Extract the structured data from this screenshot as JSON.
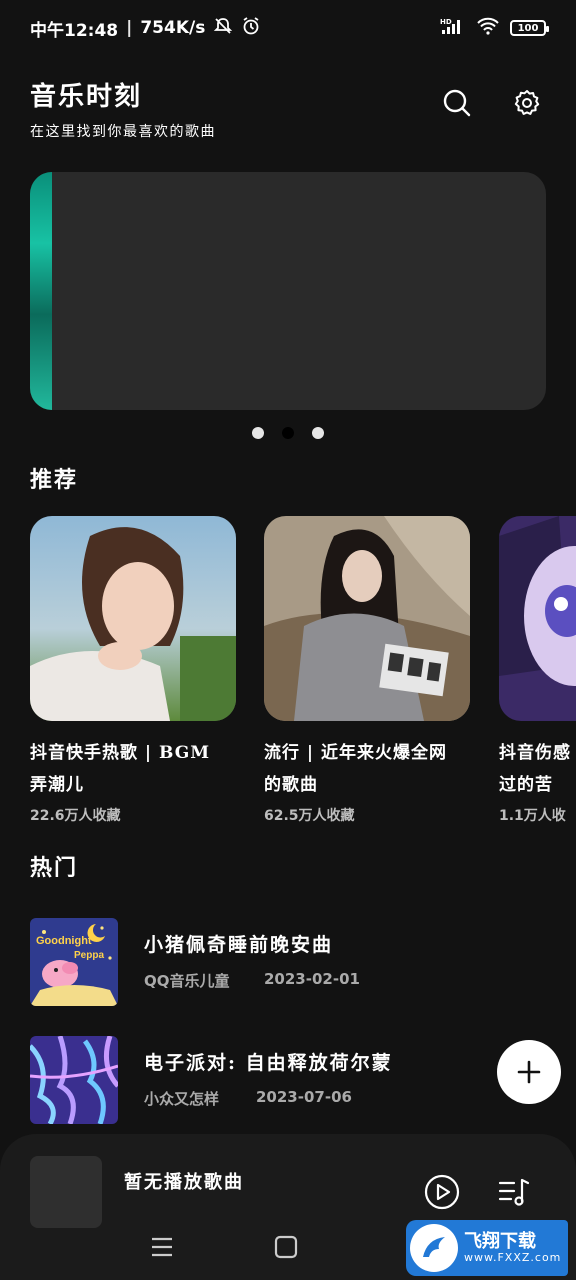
{
  "status": {
    "time": "中午12:48",
    "speed": "754K/s",
    "network": "HD",
    "battery": "100"
  },
  "header": {
    "title": "音乐时刻",
    "subtitle": "在这里找到你最喜欢的歌曲",
    "search_icon": "search-icon",
    "settings_icon": "gear-icon"
  },
  "banner": {
    "page_count": 3,
    "active_index": 1
  },
  "recommend": {
    "title": "推荐",
    "items": [
      {
        "title_line1": "抖音快手热歌 | BGM",
        "title_line2": "弄潮儿",
        "favorites": "22.6万人收藏"
      },
      {
        "title_line1": "流行 | 近年来火爆全网",
        "title_line2": "的歌曲",
        "favorites": "62.5万人收藏"
      },
      {
        "title_line1": "抖音伤感",
        "title_line2": "过的苦",
        "favorites": "1.1万人收"
      }
    ]
  },
  "hot": {
    "title": "热门",
    "items": [
      {
        "title": "小猪佩奇睡前晚安曲",
        "artist": "QQ音乐儿童",
        "date": "2023-02-01",
        "cover_text_1": "Goodnight",
        "cover_text_2": "Peppa"
      },
      {
        "title": "电子派对: 自由释放荷尔蒙",
        "artist": "小众又怎样",
        "date": "2023-07-06"
      }
    ]
  },
  "player": {
    "title": "暂无播放歌曲",
    "play_icon": "play-icon",
    "playlist_icon": "playlist-icon"
  },
  "fab": {
    "icon": "plus-icon"
  },
  "watermark": {
    "main": "飞翔下载",
    "sub": "www.FXXZ.com"
  },
  "colors": {
    "background": "#121212",
    "surface": "#1b1b1b",
    "banner": "#2a2a2a",
    "accent": "#18c2a4"
  }
}
